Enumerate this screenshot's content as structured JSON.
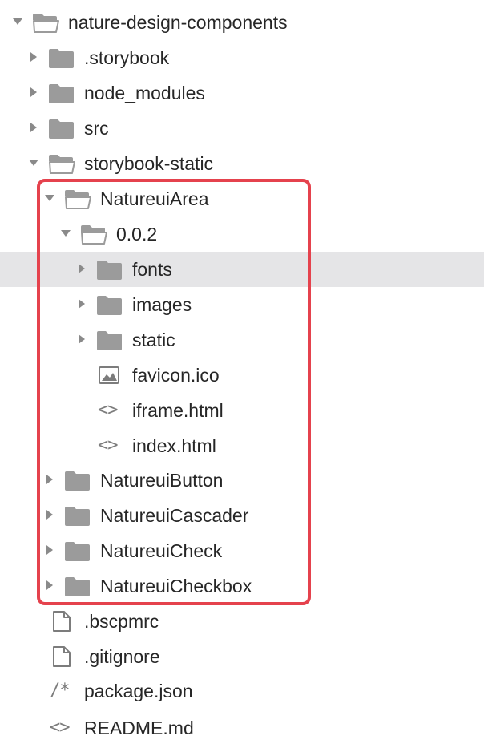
{
  "tree": {
    "root": {
      "label": "nature-design-components",
      "expanded": true
    },
    "storybook_config": {
      "label": ".storybook"
    },
    "node_modules": {
      "label": "node_modules"
    },
    "src": {
      "label": "src"
    },
    "storybook_static": {
      "label": "storybook-static",
      "expanded": true,
      "natureui_area": {
        "label": "NatureuiArea",
        "expanded": true,
        "version": {
          "label": "0.0.2",
          "expanded": true,
          "fonts": {
            "label": "fonts",
            "selected": true
          },
          "images": {
            "label": "images"
          },
          "static": {
            "label": "static"
          },
          "favicon": {
            "label": "favicon.ico"
          },
          "iframe": {
            "label": "iframe.html"
          },
          "index": {
            "label": "index.html"
          }
        }
      },
      "natureui_button": {
        "label": "NatureuiButton"
      },
      "natureui_cascader": {
        "label": "NatureuiCascader"
      },
      "natureui_check": {
        "label": "NatureuiCheck"
      },
      "natureui_checkbox": {
        "label": "NatureuiCheckbox"
      }
    },
    "bscpmrc": {
      "label": ".bscpmrc"
    },
    "gitignore": {
      "label": ".gitignore"
    },
    "package_json": {
      "label": "package.json"
    },
    "readme": {
      "label": "README.md"
    }
  },
  "glyphs": {
    "html_icon_text": "<>",
    "json_icon_text": "/*"
  },
  "icons": {
    "folder": "folder-icon",
    "open_folder": "folder-open-icon",
    "image_file": "image-file-icon",
    "code_file": "code-file-icon",
    "json_file": "json-file-icon",
    "document": "document-icon",
    "expanded_toggle": "chevron-down-icon",
    "collapsed_toggle": "chevron-right-icon"
  },
  "colors": {
    "folder": "#9b9b9b",
    "toggle": "#8a8a8a",
    "selection_background": "#e5e5e7",
    "highlight_outline": "#e5424d",
    "text": "#262626"
  }
}
